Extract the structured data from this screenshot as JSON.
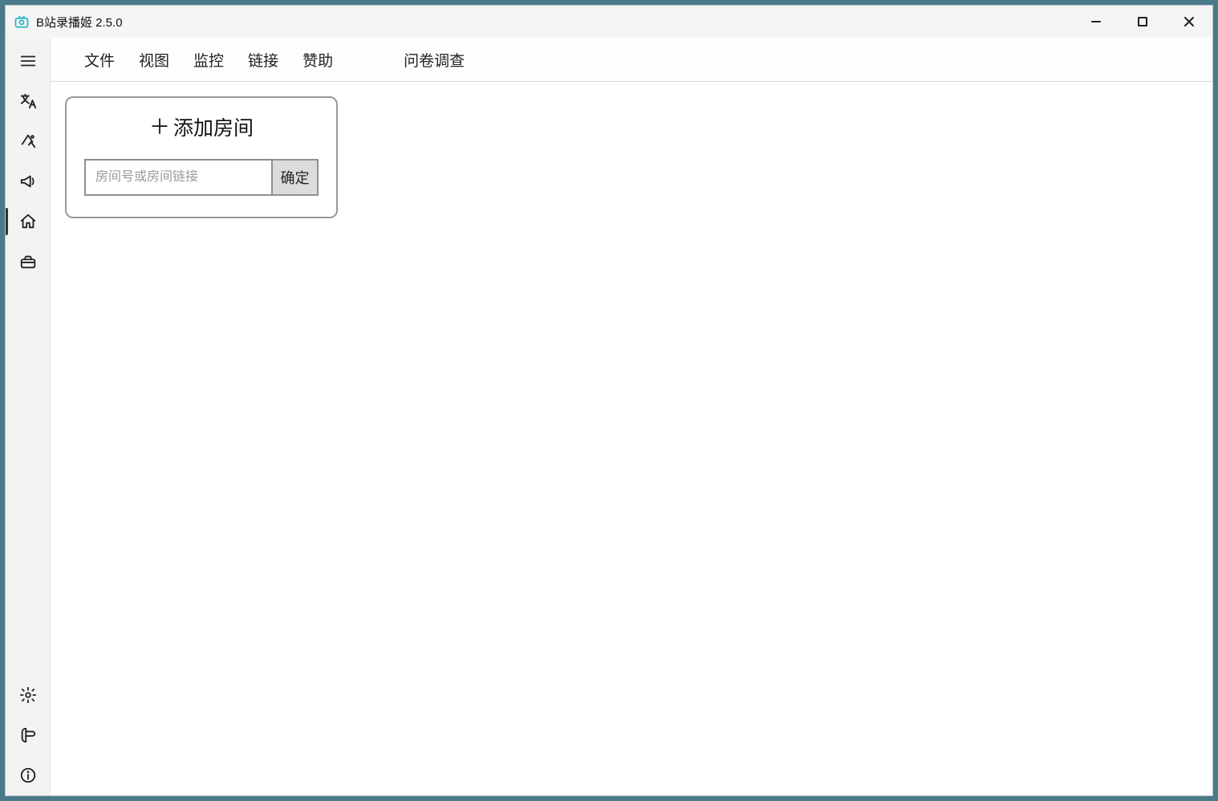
{
  "window": {
    "title": "B站录播姬 2.5.0"
  },
  "menu": {
    "file": "文件",
    "view": "视图",
    "monitor": "监控",
    "link": "链接",
    "sponsor": "赞助",
    "survey": "问卷调查"
  },
  "sidebar_icons": {
    "hamburger": "hamburger-icon",
    "language": "language-icon",
    "theme": "theme-icon",
    "announce": "announce-icon",
    "home": "home-icon",
    "toolbox": "toolbox-icon",
    "settings": "settings-icon",
    "log": "log-icon",
    "info": "info-icon"
  },
  "add_room_card": {
    "title": "添加房间",
    "plus": "＋",
    "placeholder": "房间号或房间链接",
    "confirm": "确定"
  }
}
